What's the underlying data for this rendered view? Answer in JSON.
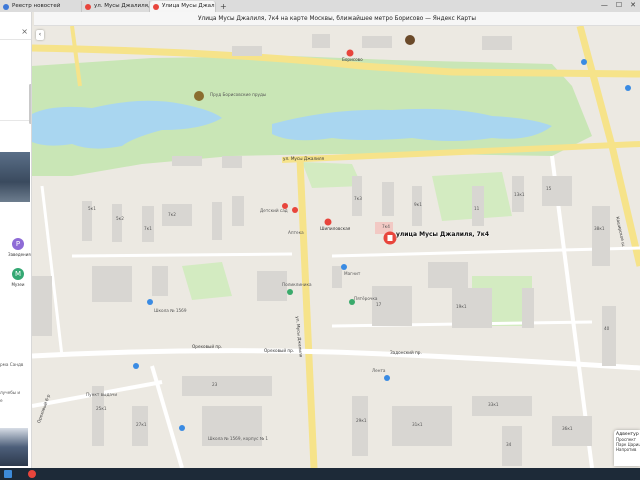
{
  "browser": {
    "tabs": [
      {
        "label": "Реестр новостей",
        "color": "#3c78d8",
        "active": false
      },
      {
        "label": "ул. Мусы Джалиля, д. 7, к.",
        "color": "#e8453c",
        "active": false
      },
      {
        "label": "Улица Мусы Джалиля...",
        "color": "#e8453c",
        "active": true
      }
    ],
    "new_tab": "+",
    "close_glyph": "×",
    "window_controls": {
      "minimize": "—",
      "maximize": "☐",
      "close": "✕"
    },
    "page_title": "Улица Мусы Джалиля, 7к4 на карте Москвы, ближайшее метро Борисово — Яндекс Карты"
  },
  "sidebar": {
    "search_placeholder": "",
    "clear_glyph": "×",
    "categories": [
      {
        "label": "Заведения",
        "color": "#8e6bd6",
        "glyph": "P"
      },
      {
        "label": "Музеи",
        "color": "#34a873",
        "glyph": "M"
      }
    ],
    "promo_text": "рма Сандв",
    "promo_text2": "лучебы и",
    "promo_text3": "е"
  },
  "map": {
    "selected_place": "улица Мусы Джалиля, 7к4",
    "streets": [
      {
        "name": "ул. Мусы Джалиля",
        "id": "street-musy-dzhalilya-top"
      },
      {
        "name": "ул. Мусы Джалиля",
        "id": "street-musy-dzhalilya-vertical"
      },
      {
        "name": "Ореховый пр.",
        "id": "street-orekhovy"
      },
      {
        "name": "Ореховый пр.",
        "id": "street-orekhovy-2"
      },
      {
        "name": "Задонский пр.",
        "id": "street-zadonsky"
      },
      {
        "name": "Ореховый б-р",
        "id": "street-orekhovy-blvd"
      },
      {
        "name": "Каширское ш.",
        "id": "street-kashirskoe"
      }
    ],
    "metro": [
      {
        "name": "Борисово",
        "color": "#c7a6d9"
      },
      {
        "name": "Шипиловская",
        "color": "#c7a6d9"
      }
    ],
    "pois": [
      {
        "name": "Пруд Борисовские пруды"
      },
      {
        "name": "Школа № 1569"
      },
      {
        "name": "Поликлиника"
      },
      {
        "name": "Магнит"
      },
      {
        "name": "Пятёрочка"
      },
      {
        "name": "Детский сад"
      },
      {
        "name": "Аптека"
      },
      {
        "name": "Лента"
      },
      {
        "name": "Школа № 1569, корпус № 1"
      },
      {
        "name": "Пункт выдачи"
      }
    ],
    "buildings": [
      "5к1",
      "5к2",
      "7к1",
      "7к2",
      "7к3",
      "7к4",
      "9к1",
      "11",
      "13к1",
      "15",
      "17",
      "19к1",
      "23",
      "25к1",
      "27к1",
      "29к1",
      "31к1",
      "33к1",
      "34",
      "36к1",
      "38к1",
      "40"
    ],
    "info_card": {
      "title": "Адвентур",
      "lines": [
        "Проспект",
        "Парк Царицыно",
        "Напротив"
      ]
    }
  },
  "colors": {
    "park": "#c9e6b6",
    "water": "#a9d6f0",
    "road_major": "#f6e38a",
    "road": "#ffffff",
    "building": "#dadada",
    "accent": "#e8453c"
  }
}
